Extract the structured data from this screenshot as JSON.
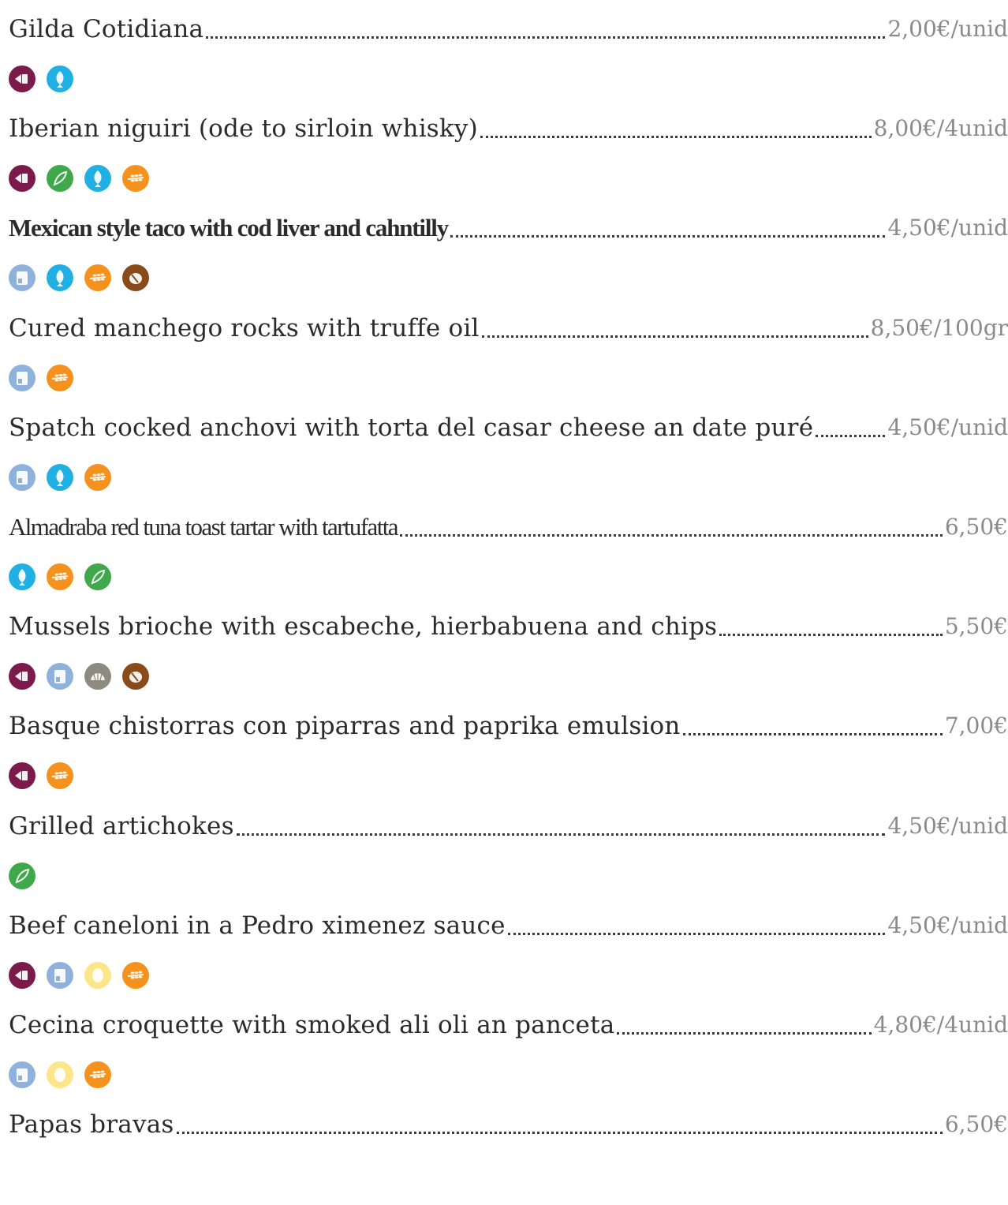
{
  "allergen_colors": {
    "sulphites": "#7b1a4b",
    "celery": "#3fa84a",
    "fish": "#21b0e3",
    "gluten": "#f4921d",
    "nuts": "#8a4b1b",
    "milk": "#8fb2dd",
    "molluscs": "#8d8a80",
    "egg": "#fde68a"
  },
  "items": [
    {
      "name": "Gilda Cotidiana",
      "price": "2,00€/unid",
      "style": "regular",
      "icons": [
        "sulphites",
        "fish"
      ]
    },
    {
      "name": "Iberian niguiri (ode to sirloin whisky)",
      "price": "8,00€/4unid",
      "style": "regular",
      "icons": [
        "sulphites",
        "celery",
        "fish",
        "gluten"
      ]
    },
    {
      "name": "Mexican style taco with cod liver and cahntilly",
      "price": "4,50€/unid",
      "style": "bold",
      "icons": [
        "milk",
        "fish",
        "gluten",
        "nuts"
      ]
    },
    {
      "name": "Cured manchego rocks with truffe oil",
      "price": "8,50€/100gr",
      "style": "regular",
      "icons": [
        "milk",
        "gluten"
      ]
    },
    {
      "name": "Spatch cocked anchovi with torta del casar cheese an date puré",
      "price": "4,50€/unid",
      "style": "regular",
      "icons": [
        "milk",
        "fish",
        "gluten"
      ]
    },
    {
      "name": "Almadraba red tuna toast tartar with tartufatta",
      "price": "6,50€",
      "style": "condensed",
      "icons": [
        "fish",
        "gluten",
        "celery"
      ]
    },
    {
      "name": "Mussels brioche with escabeche, hierbabuena and chips",
      "price": "5,50€",
      "style": "regular",
      "icons": [
        "sulphites",
        "milk",
        "molluscs",
        "nuts"
      ]
    },
    {
      "name": "Basque chistorras con piparras and paprika emulsion",
      "price": "7,00€",
      "style": "regular",
      "icons": [
        "sulphites",
        "gluten"
      ]
    },
    {
      "name": "Grilled artichokes",
      "price": "4,50€/unid",
      "style": "regular",
      "icons": [
        "celery"
      ]
    },
    {
      "name": "Beef caneloni in a Pedro ximenez sauce",
      "price": "4,50€/unid",
      "style": "regular",
      "icons": [
        "sulphites",
        "milk",
        "egg",
        "gluten"
      ]
    },
    {
      "name": "Cecina croquette with smoked ali oli an panceta",
      "price": "4,80€/4unid",
      "style": "regular",
      "icons": [
        "milk",
        "egg",
        "gluten"
      ]
    },
    {
      "name": "Papas bravas",
      "price": "6,50€",
      "style": "regular",
      "icons": []
    }
  ]
}
